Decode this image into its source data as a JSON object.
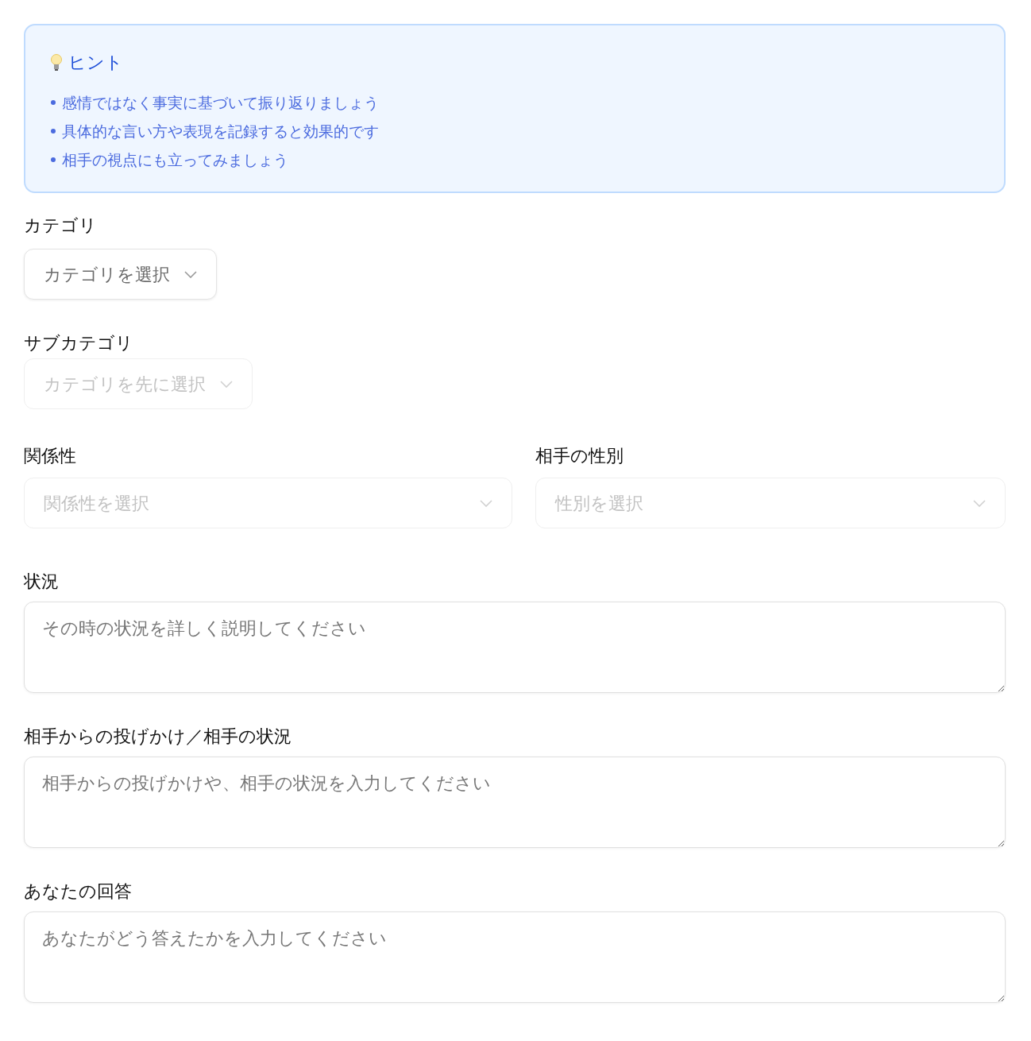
{
  "hint": {
    "title": "ヒント",
    "items": [
      "感情ではなく事実に基づいて振り返りましょう",
      "具体的な言い方や表現を記録すると効果的です",
      "相手の視点にも立ってみましょう"
    ]
  },
  "fields": [
    {
      "kind": "select",
      "label": "カテゴリ",
      "placeholder": "カテゴリを選択",
      "disabled": false
    },
    {
      "kind": "select",
      "label": "サブカテゴリ",
      "placeholder": "カテゴリを先に選択",
      "disabled": true
    },
    {
      "kind": "pair",
      "items": [
        {
          "label": "関係性",
          "placeholder": "関係性を選択",
          "disabled": true
        },
        {
          "label": "相手の性別",
          "placeholder": "性別を選択",
          "disabled": true
        }
      ]
    },
    {
      "kind": "textarea",
      "label": "状況",
      "placeholder": "その時の状況を詳しく説明してください"
    },
    {
      "kind": "textarea",
      "label": "相手からの投げかけ／相手の状況",
      "placeholder": "相手からの投げかけや、相手の状況を入力してください"
    },
    {
      "kind": "textarea",
      "label": "あなたの回答",
      "placeholder": "あなたがどう答えたかを入力してください"
    }
  ]
}
